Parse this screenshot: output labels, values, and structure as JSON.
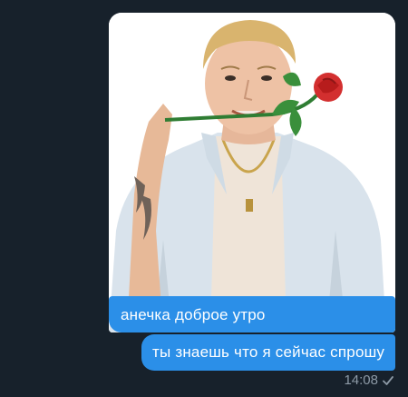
{
  "messages": [
    {
      "type": "photo",
      "description_icon": "portrait-with-rose"
    },
    {
      "type": "text",
      "text": "анечка доброе утро"
    },
    {
      "type": "text",
      "text": "ты знаешь что я сейчас спрошу"
    }
  ],
  "meta": {
    "time": "14:08",
    "status_icon": "check-icon"
  },
  "colors": {
    "background": "#17212b",
    "bubble": "#2b8fe8",
    "meta_text": "#8d9aa6"
  }
}
